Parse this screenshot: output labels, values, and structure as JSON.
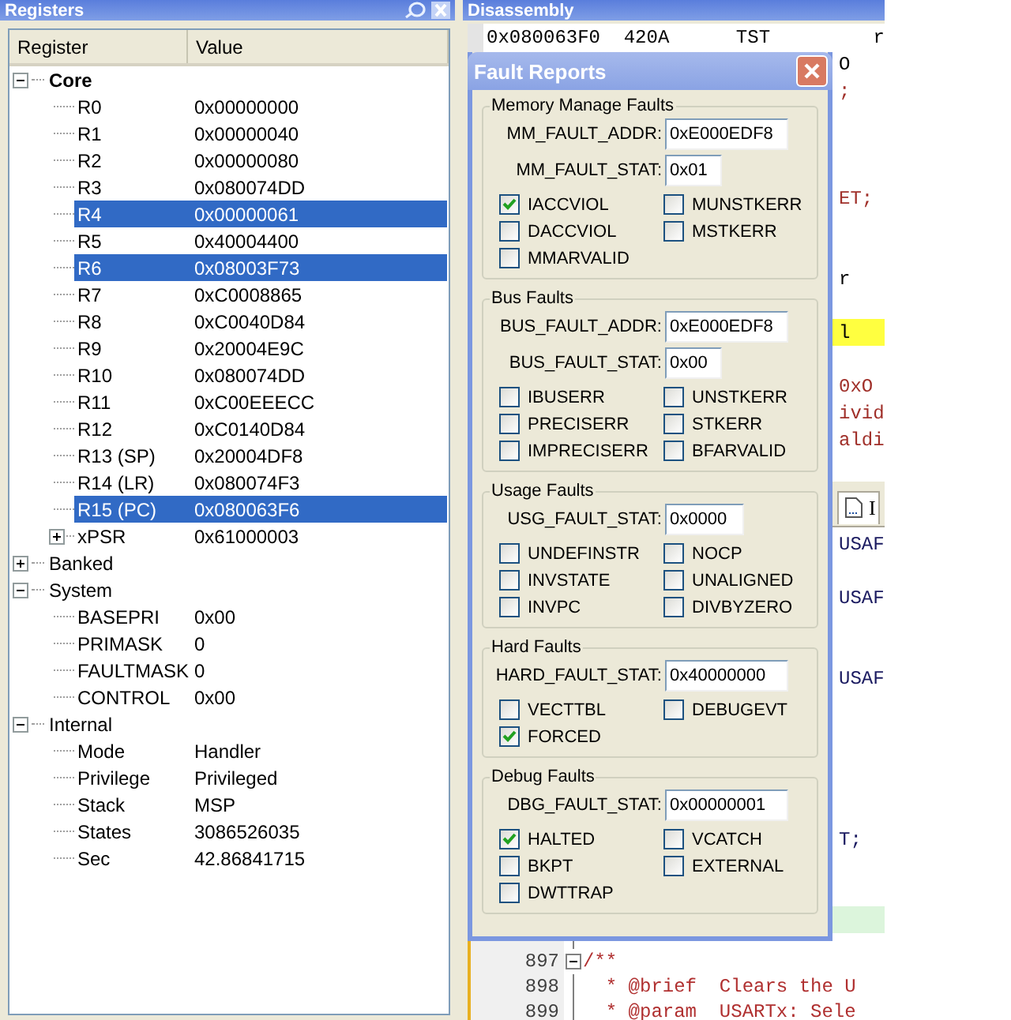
{
  "registers": {
    "title": "Registers",
    "columns": [
      "Register",
      "Value"
    ],
    "tree": [
      {
        "name": "Core",
        "bold": true,
        "expanded": true,
        "children": [
          {
            "name": "R0",
            "value": "0x00000000",
            "selected": false
          },
          {
            "name": "R1",
            "value": "0x00000040",
            "selected": false
          },
          {
            "name": "R2",
            "value": "0x00000080",
            "selected": false
          },
          {
            "name": "R3",
            "value": "0x080074DD",
            "selected": false
          },
          {
            "name": "R4",
            "value": "0x00000061",
            "selected": true
          },
          {
            "name": "R5",
            "value": "0x40004400",
            "selected": false
          },
          {
            "name": "R6",
            "value": "0x08003F73",
            "selected": true
          },
          {
            "name": "R7",
            "value": "0xC0008865",
            "selected": false
          },
          {
            "name": "R8",
            "value": "0xC0040D84",
            "selected": false
          },
          {
            "name": "R9",
            "value": "0x20004E9C",
            "selected": false
          },
          {
            "name": "R10",
            "value": "0x080074DD",
            "selected": false
          },
          {
            "name": "R11",
            "value": "0xC00EEECC",
            "selected": false
          },
          {
            "name": "R12",
            "value": "0xC0140D84",
            "selected": false
          },
          {
            "name": "R13 (SP)",
            "value": "0x20004DF8",
            "selected": false
          },
          {
            "name": "R14 (LR)",
            "value": "0x080074F3",
            "selected": false
          },
          {
            "name": "R15 (PC)",
            "value": "0x080063F6",
            "selected": true
          },
          {
            "name": "xPSR",
            "value": "0x61000003",
            "selected": false,
            "expanded": false
          }
        ]
      },
      {
        "name": "Banked",
        "bold": false,
        "expanded": false
      },
      {
        "name": "System",
        "bold": false,
        "expanded": true,
        "children": [
          {
            "name": "BASEPRI",
            "value": "0x00",
            "selected": false
          },
          {
            "name": "PRIMASK",
            "value": "0",
            "selected": false
          },
          {
            "name": "FAULTMASK",
            "value": "0",
            "selected": false
          },
          {
            "name": "CONTROL",
            "value": "0x00",
            "selected": false
          }
        ]
      },
      {
        "name": "Internal",
        "bold": false,
        "expanded": true,
        "children": [
          {
            "name": "Mode",
            "value": "Handler",
            "selected": false
          },
          {
            "name": "Privilege",
            "value": "Privileged",
            "selected": false
          },
          {
            "name": "Stack",
            "value": "MSP",
            "selected": false
          },
          {
            "name": "States",
            "value": "3086526035",
            "selected": false
          },
          {
            "name": "Sec",
            "value": "42.86841715",
            "selected": false
          }
        ]
      }
    ]
  },
  "disassembly": {
    "title": "Disassembly",
    "top_line": {
      "address": "0x080063F0",
      "opcode": "420A",
      "mnemonic": "TST",
      "operand": "r"
    },
    "rows": [
      {
        "text": "O",
        "kind": "code"
      },
      {
        "text": ";",
        "kind": "source"
      },
      {
        "kind": "blank"
      },
      {
        "kind": "blank"
      },
      {
        "kind": "blank"
      },
      {
        "text": "ET;",
        "kind": "source"
      },
      {
        "kind": "blank"
      },
      {
        "kind": "blank"
      },
      {
        "text": "r",
        "kind": "code"
      },
      {
        "kind": "blank"
      },
      {
        "text": "l",
        "kind": "current"
      },
      {
        "kind": "blank"
      },
      {
        "text": "0xO",
        "kind": "source"
      },
      {
        "text": "ivid",
        "kind": "source"
      },
      {
        "text": "aldi",
        "kind": "source"
      }
    ]
  },
  "editor": {
    "tab": "I",
    "rows": [
      {
        "text": "USAF",
        "kind": "code"
      },
      {
        "kind": "blank"
      },
      {
        "text": "USAF",
        "kind": "code"
      },
      {
        "kind": "blank"
      },
      {
        "kind": "blank"
      },
      {
        "text": "USAF",
        "kind": "code"
      },
      {
        "kind": "blank"
      },
      {
        "kind": "blank"
      },
      {
        "kind": "blank"
      },
      {
        "kind": "blank"
      },
      {
        "kind": "blank"
      },
      {
        "text": "T;",
        "kind": "code"
      },
      {
        "kind": "blank"
      },
      {
        "kind": "blank"
      },
      {
        "kind": "marked"
      }
    ],
    "lines": [
      {
        "fold": false
      },
      {
        "number": "897",
        "text": "/**",
        "fold": true
      },
      {
        "number": "898",
        "text": "  * @brief  Clears the U",
        "fold": false
      },
      {
        "number": "899",
        "text": "  * @param  USARTx: Sele",
        "fold": false
      }
    ]
  },
  "fault_reports": {
    "title": "Fault Reports",
    "groups": [
      {
        "title": "Memory Manage Faults",
        "fields": [
          {
            "label": "MM_FAULT_ADDR:",
            "value": "0xE000EDF8"
          },
          {
            "label": "MM_FAULT_STAT:",
            "value": "0x01"
          }
        ],
        "flags": [
          {
            "label": "IACCVIOL",
            "checked": true
          },
          {
            "label": "MUNSTKERR",
            "checked": false
          },
          {
            "label": "DACCVIOL",
            "checked": false
          },
          {
            "label": "MSTKERR",
            "checked": false
          },
          {
            "label": "MMARVALID",
            "checked": false
          }
        ]
      },
      {
        "title": "Bus Faults",
        "fields": [
          {
            "label": "BUS_FAULT_ADDR:",
            "value": "0xE000EDF8"
          },
          {
            "label": "BUS_FAULT_STAT:",
            "value": "0x00"
          }
        ],
        "flags": [
          {
            "label": "IBUSERR",
            "checked": false
          },
          {
            "label": "UNSTKERR",
            "checked": false
          },
          {
            "label": "PRECISERR",
            "checked": false
          },
          {
            "label": "STKERR",
            "checked": false
          },
          {
            "label": "IMPRECISERR",
            "checked": false
          },
          {
            "label": "BFARVALID",
            "checked": false
          }
        ]
      },
      {
        "title": "Usage Faults",
        "fields": [
          {
            "label": "USG_FAULT_STAT:",
            "value": "0x0000"
          }
        ],
        "flags": [
          {
            "label": "UNDEFINSTR",
            "checked": false
          },
          {
            "label": "NOCP",
            "checked": false
          },
          {
            "label": "INVSTATE",
            "checked": false
          },
          {
            "label": "UNALIGNED",
            "checked": false
          },
          {
            "label": "INVPC",
            "checked": false
          },
          {
            "label": "DIVBYZERO",
            "checked": false
          }
        ]
      },
      {
        "title": "Hard Faults",
        "fields": [
          {
            "label": "HARD_FAULT_STAT:",
            "value": "0x40000000"
          }
        ],
        "flags": [
          {
            "label": "VECTTBL",
            "checked": false
          },
          {
            "label": "DEBUGEVT",
            "checked": false
          },
          {
            "label": "FORCED",
            "checked": true
          }
        ]
      },
      {
        "title": "Debug Faults",
        "fields": [
          {
            "label": "DBG_FAULT_STAT:",
            "value": "0x00000001"
          }
        ],
        "flags": [
          {
            "label": "HALTED",
            "checked": true
          },
          {
            "label": "VCATCH",
            "checked": false
          },
          {
            "label": "BKPT",
            "checked": false
          },
          {
            "label": "EXTERNAL",
            "checked": false
          },
          {
            "label": "DWTTRAP",
            "checked": false
          }
        ]
      }
    ]
  }
}
